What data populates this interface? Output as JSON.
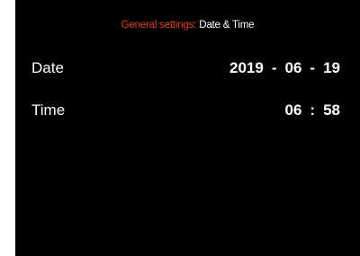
{
  "header": {
    "section": "General settings:",
    "page": "Date & Time",
    "section_color": "#e0411a"
  },
  "date": {
    "label": "Date",
    "year": "2019",
    "month": "06",
    "day": "19",
    "separator": "-"
  },
  "time": {
    "label": "Time",
    "hour": "06",
    "minute": "58",
    "separator": ":"
  }
}
